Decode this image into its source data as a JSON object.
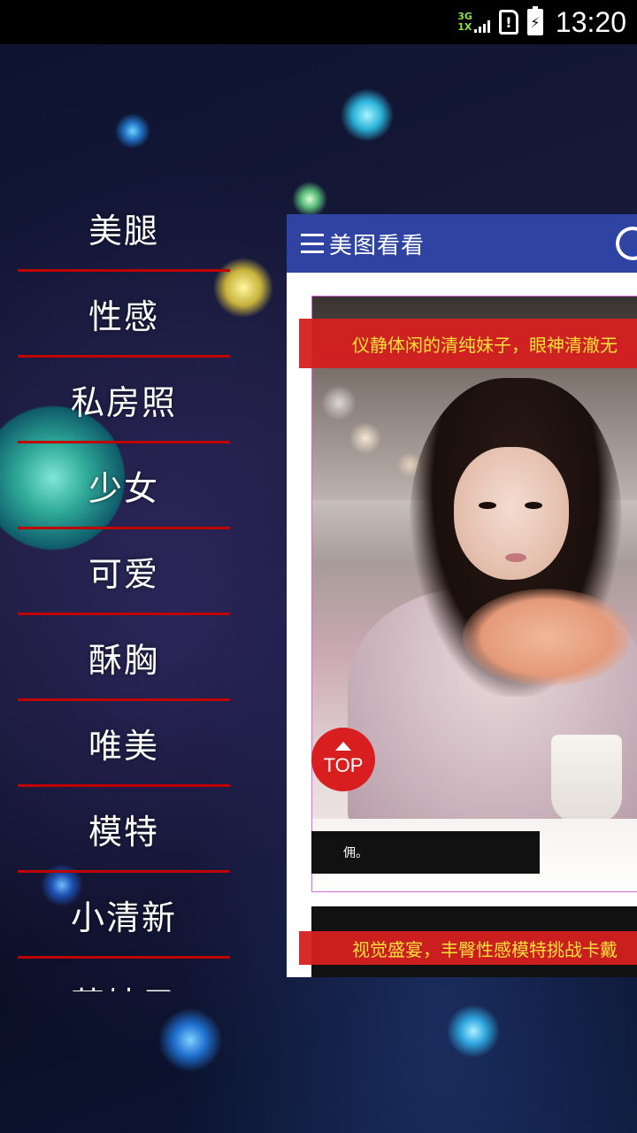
{
  "status_bar": {
    "network_top": "3G",
    "network_bottom": "1X",
    "sim_glyph": "!",
    "battery_glyph": "⚡",
    "time": "13:20",
    "icons": [
      "signal-icon",
      "sim-alert-icon",
      "battery-charging-icon"
    ]
  },
  "menu": {
    "items": [
      {
        "label": "美腿"
      },
      {
        "label": "性感"
      },
      {
        "label": "私房照"
      },
      {
        "label": "少女"
      },
      {
        "label": "可爱"
      },
      {
        "label": "酥胸"
      },
      {
        "label": "唯美"
      },
      {
        "label": "模特"
      },
      {
        "label": "小清新"
      },
      {
        "label": "萌妹子"
      }
    ],
    "divider_color": "#c00000"
  },
  "toolbar": {
    "title": "美图看看",
    "background": "#2f43a2",
    "menu_icon": "hamburger-icon",
    "refresh_icon": "refresh-icon"
  },
  "feed": {
    "items": [
      {
        "title": "仪静体闲的清纯妹子，眼神清澈无",
        "caption": "佣。"
      },
      {
        "title": "视觉盛宴，丰臀性感模特挑战卡戴",
        "caption": ""
      }
    ],
    "banner_color": "#d62020",
    "banner_text_color": "#f4e23a"
  },
  "top_button": {
    "label": "TOP",
    "icon": "arrow-up-icon",
    "color": "#d81e1e"
  }
}
